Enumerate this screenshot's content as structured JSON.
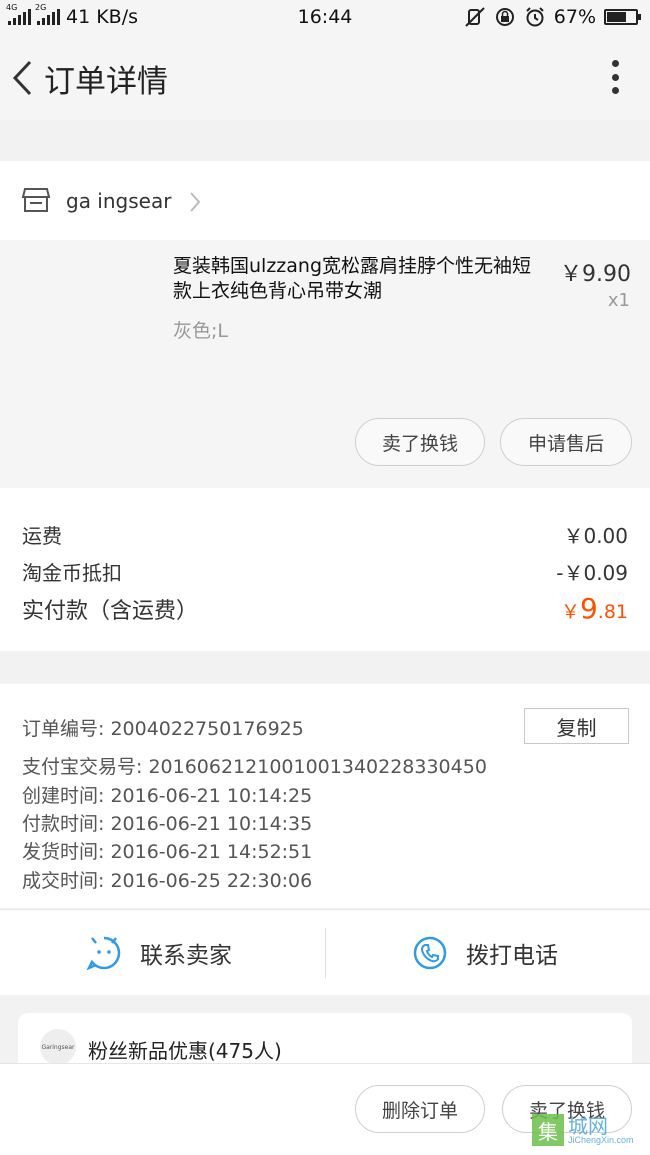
{
  "status_bar": {
    "network_4g": "4G",
    "network_2g": "2G",
    "speed": "41 KB/s",
    "time": "16:44",
    "battery": "67%",
    "battery_level": 0.67
  },
  "header": {
    "title": "订单详情"
  },
  "shop": {
    "name": "ga ingsear"
  },
  "product": {
    "title": "夏装韩国ulzzang宽松露肩挂脖个性无袖短款上衣纯色背心吊带女潮",
    "sku": "灰色;L",
    "price": "￥9.90",
    "quantity": "x1",
    "buttons": {
      "sell": "卖了换钱",
      "after_sale": "申请售后"
    }
  },
  "fees": {
    "shipping_label": "运费",
    "shipping_value": "￥0.00",
    "coin_label": "淘金币抵扣",
    "coin_value": "-￥0.09",
    "total_label": "实付款（含运费）",
    "total_currency": "￥",
    "total_int": "9",
    "total_dec": ".81"
  },
  "order_info": {
    "order_no": "订单编号:   2004022750176925",
    "alipay_no": "支付宝交易号:   2016062121001001340228330450",
    "created": "创建时间:   2016-06-21 10:14:25",
    "paid": "付款时间:   2016-06-21 10:14:35",
    "shipped": "发货时间:   2016-06-21 14:52:51",
    "completed": "成交时间:   2016-06-25 22:30:06",
    "copy_label": "复制"
  },
  "contact": {
    "seller": "联系卖家",
    "phone": "拨打电话"
  },
  "fans": {
    "logo_text": "Garingsear",
    "text": "粉丝新品优惠(475人)"
  },
  "bottom": {
    "delete": "删除订单",
    "sell": "卖了换钱"
  },
  "watermark": {
    "glyph": "集",
    "cn": "城网",
    "en": "JiChengXin.com"
  },
  "colors": {
    "accent": "#ff5000",
    "icon_blue": "#2f9be6"
  }
}
